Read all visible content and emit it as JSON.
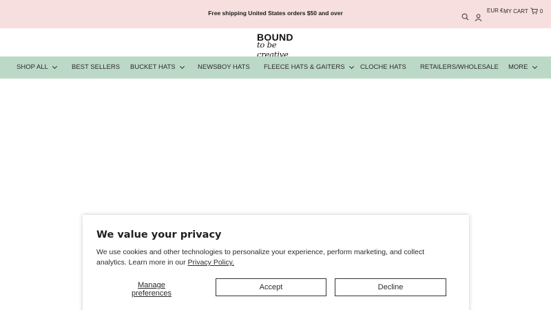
{
  "announcement": {
    "text": "Free shipping United States orders $50 and over"
  },
  "header": {
    "currency": "EUR €",
    "cart_label": "MY CART",
    "cart_count": "0",
    "logo_top": "BOUND",
    "logo_bottom": "to be creative"
  },
  "nav": {
    "items": [
      {
        "label": "SHOP ALL",
        "has_dropdown": true
      },
      {
        "label": "BEST SELLERS",
        "has_dropdown": false
      },
      {
        "label": "BUCKET HATS",
        "has_dropdown": true
      },
      {
        "label": "NEWSBOY HATS",
        "has_dropdown": false
      },
      {
        "label": "FLEECE HATS & GAITERS",
        "has_dropdown": true
      },
      {
        "label": "CLOCHE HATS",
        "has_dropdown": false
      },
      {
        "label": "RETAILERS/WHOLESALE",
        "has_dropdown": false
      },
      {
        "label": "MORE",
        "has_dropdown": true
      }
    ]
  },
  "privacy": {
    "title": "We value your privacy",
    "body": "We use cookies and other technologies to personalize your experience, perform marketing, and collect analytics. Learn more in our",
    "link": "Privacy Policy.",
    "manage": "Manage preferences",
    "accept": "Accept",
    "decline": "Decline"
  },
  "colors": {
    "announcement_bg": "#f6dfde",
    "nav_bg": "#bcd9c8"
  },
  "icons": [
    "search-icon",
    "account-icon",
    "cart-icon",
    "chevron-down-icon"
  ]
}
